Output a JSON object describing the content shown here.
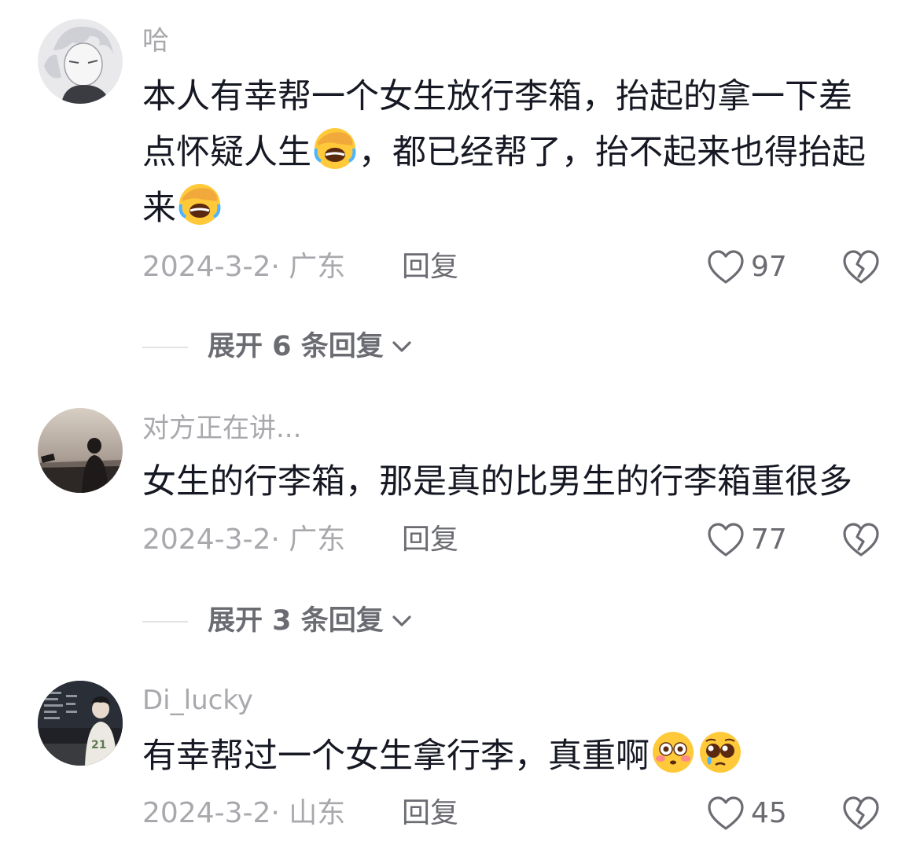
{
  "comments": [
    {
      "username": "哈",
      "text_parts": [
        "本人有幸帮一个女生放行李箱，抬起的拿一下差点怀疑人生",
        "，都已经帮了，抬不起来也得抬起来"
      ],
      "emojis": [
        "facepalm-laugh",
        "facepalm-laugh"
      ],
      "date_location": "2024-3-2· 广东",
      "reply_label": "回复",
      "likes": "97",
      "expand_label": "展开 6 条回复"
    },
    {
      "username": "对方正在讲...",
      "text": "女生的行李箱，那是真的比男生的行李箱重很多",
      "date_location": "2024-3-2· 广东",
      "reply_label": "回复",
      "likes": "77",
      "expand_label": "展开 3 条回复"
    },
    {
      "username": "Di_lucky",
      "text": "有幸帮过一个女生拿行李，真重啊",
      "emojis": [
        "flushed-face",
        "pleading-face"
      ],
      "date_location": "2024-3-2· 山东",
      "reply_label": "回复",
      "likes": "45"
    }
  ],
  "icons": {
    "like": "heart-outline-icon",
    "dislike": "broken-heart-icon",
    "expand": "chevron-down-icon"
  },
  "colors": {
    "primary_text": "#161823",
    "secondary_text": "#a8a8ad",
    "action_text": "#6b6c72",
    "emoji_yellow": "#ffc93a"
  }
}
